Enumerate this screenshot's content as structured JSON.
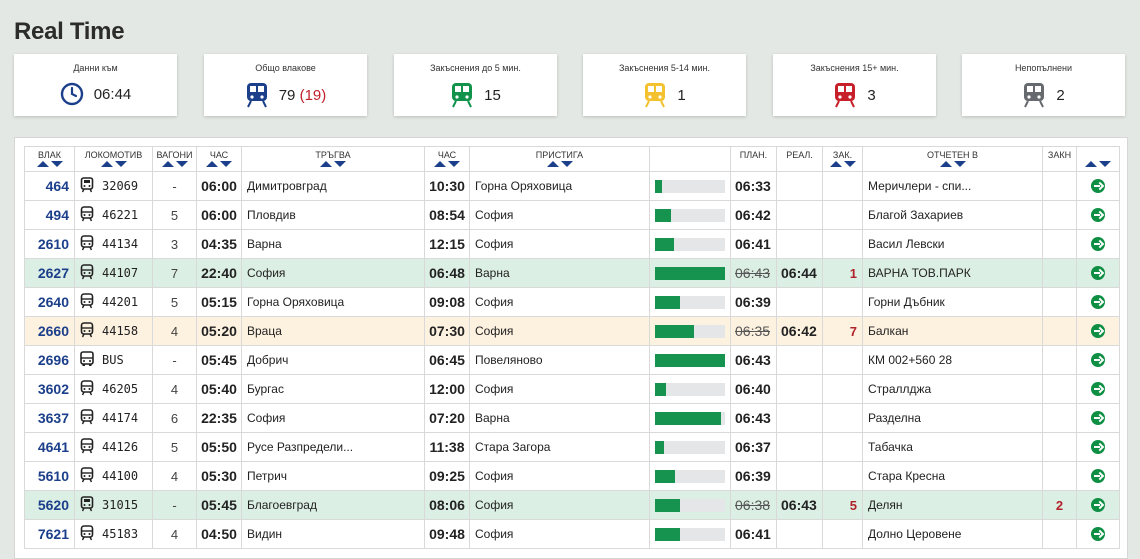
{
  "page": {
    "title": "Real Time"
  },
  "cards": [
    {
      "label": "Данни към",
      "value": "06:44",
      "extra": "",
      "icon": "clock-icon",
      "color": "#1b3f8a"
    },
    {
      "label": "Общо влакове",
      "value": "79",
      "extra": "(19)",
      "icon": "train-icon",
      "color": "#1b3f8a"
    },
    {
      "label": "Закъснения до 5 мин.",
      "value": "15",
      "extra": "",
      "icon": "train-icon",
      "color": "#11934c"
    },
    {
      "label": "Закъснения 5-14 мин.",
      "value": "1",
      "extra": "",
      "icon": "train-icon",
      "color": "#f4c12f"
    },
    {
      "label": "Закъснения 15+ мин.",
      "value": "3",
      "extra": "",
      "icon": "train-icon",
      "color": "#c8202b"
    },
    {
      "label": "Непопълнени",
      "value": "2",
      "extra": "",
      "icon": "train-icon",
      "color": "#666a6e"
    }
  ],
  "table": {
    "headers": {
      "train": "ВЛАК",
      "loco": "ЛОКОМОТИВ",
      "wagons": "ВАГОНИ",
      "dep_time": "ЧАС",
      "departs": "ТРЪГВА",
      "arr_time": "ЧАС",
      "arrives": "ПРИСТИГА",
      "planned": "ПЛАН.",
      "real": "РЕАЛ.",
      "delay": "ЗАК.",
      "reported": "ОТЧЕТЕН В",
      "delay2": "ЗАКН"
    },
    "rows": [
      {
        "train": "464",
        "loco": "32069",
        "loco_icon": "locomotive-icon",
        "wagons": "-",
        "dep": "06:00",
        "from": "Димитровград",
        "arr": "10:30",
        "to": "Горна Оряховица",
        "progress": 0.1,
        "planned": "06:33",
        "planned_struck": false,
        "real": "",
        "delay": "",
        "reported": "Меричлери - спи...",
        "delay2": "",
        "status": ""
      },
      {
        "train": "494",
        "loco": "46221",
        "loco_icon": "train-icon",
        "wagons": "5",
        "dep": "06:00",
        "from": "Пловдив",
        "arr": "08:54",
        "to": "София",
        "progress": 0.23,
        "planned": "06:42",
        "planned_struck": false,
        "real": "",
        "delay": "",
        "reported": "Благой Захариев",
        "delay2": "",
        "status": ""
      },
      {
        "train": "2610",
        "loco": "44134",
        "loco_icon": "train-icon",
        "wagons": "3",
        "dep": "04:35",
        "from": "Варна",
        "arr": "12:15",
        "to": "София",
        "progress": 0.27,
        "planned": "06:41",
        "planned_struck": false,
        "real": "",
        "delay": "",
        "reported": "Васил Левски",
        "delay2": "",
        "status": ""
      },
      {
        "train": "2627",
        "loco": "44107",
        "loco_icon": "train-icon",
        "wagons": "7",
        "dep": "22:40",
        "from": "София",
        "arr": "06:48",
        "to": "Варна",
        "progress": 1.0,
        "planned": "06:43",
        "planned_struck": true,
        "real": "06:44",
        "delay": "1",
        "reported": "ВАРНА ТОВ.ПАРК",
        "delay2": "",
        "status": "green"
      },
      {
        "train": "2640",
        "loco": "44201",
        "loco_icon": "train-icon",
        "wagons": "5",
        "dep": "05:15",
        "from": "Горна Оряховица",
        "arr": "09:08",
        "to": "София",
        "progress": 0.36,
        "planned": "06:39",
        "planned_struck": false,
        "real": "",
        "delay": "",
        "reported": "Горни Дъбник",
        "delay2": "",
        "status": ""
      },
      {
        "train": "2660",
        "loco": "44158",
        "loco_icon": "train-icon",
        "wagons": "4",
        "dep": "05:20",
        "from": "Враца",
        "arr": "07:30",
        "to": "София",
        "progress": 0.56,
        "planned": "06:35",
        "planned_struck": true,
        "real": "06:42",
        "delay": "7",
        "reported": "Балкан",
        "delay2": "",
        "status": "orange"
      },
      {
        "train": "2696",
        "loco": "BUS",
        "loco_icon": "bus-icon",
        "wagons": "-",
        "dep": "05:45",
        "from": "Добрич",
        "arr": "06:45",
        "to": "Повеляново",
        "progress": 1.0,
        "planned": "06:43",
        "planned_struck": false,
        "real": "",
        "delay": "",
        "reported": "КМ 002+560 28",
        "delay2": "",
        "status": ""
      },
      {
        "train": "3602",
        "loco": "46205",
        "loco_icon": "train-icon",
        "wagons": "4",
        "dep": "05:40",
        "from": "Бургас",
        "arr": "12:00",
        "to": "София",
        "progress": 0.16,
        "planned": "06:40",
        "planned_struck": false,
        "real": "",
        "delay": "",
        "reported": "Страллджа",
        "delay2": "",
        "status": ""
      },
      {
        "train": "3637",
        "loco": "44174",
        "loco_icon": "train-icon",
        "wagons": "6",
        "dep": "22:35",
        "from": "София",
        "arr": "07:20",
        "to": "Варна",
        "progress": 0.94,
        "planned": "06:43",
        "planned_struck": false,
        "real": "",
        "delay": "",
        "reported": "Разделна",
        "delay2": "",
        "status": ""
      },
      {
        "train": "4641",
        "loco": "44126",
        "loco_icon": "train-icon",
        "wagons": "5",
        "dep": "05:50",
        "from": "Русе Разпредели...",
        "arr": "11:38",
        "to": "Стара Загора",
        "progress": 0.13,
        "planned": "06:37",
        "planned_struck": false,
        "real": "",
        "delay": "",
        "reported": "Табачка",
        "delay2": "",
        "status": ""
      },
      {
        "train": "5610",
        "loco": "44100",
        "loco_icon": "train-icon",
        "wagons": "4",
        "dep": "05:30",
        "from": "Петрич",
        "arr": "09:25",
        "to": "София",
        "progress": 0.29,
        "planned": "06:39",
        "planned_struck": false,
        "real": "",
        "delay": "",
        "reported": "Стара Кресна",
        "delay2": "",
        "status": ""
      },
      {
        "train": "5620",
        "loco": "31015",
        "loco_icon": "locomotive-icon",
        "wagons": "-",
        "dep": "05:45",
        "from": "Благоевград",
        "arr": "08:06",
        "to": "София",
        "progress": 0.36,
        "planned": "06:38",
        "planned_struck": true,
        "real": "06:43",
        "delay": "5",
        "reported": "Делян",
        "delay2": "2",
        "status": "green"
      },
      {
        "train": "7621",
        "loco": "45183",
        "loco_icon": "train-icon",
        "wagons": "4",
        "dep": "04:50",
        "from": "Видин",
        "arr": "09:48",
        "to": "София",
        "progress": 0.36,
        "planned": "06:41",
        "planned_struck": false,
        "real": "",
        "delay": "",
        "reported": "Долно Церовене",
        "delay2": "",
        "status": ""
      }
    ]
  }
}
